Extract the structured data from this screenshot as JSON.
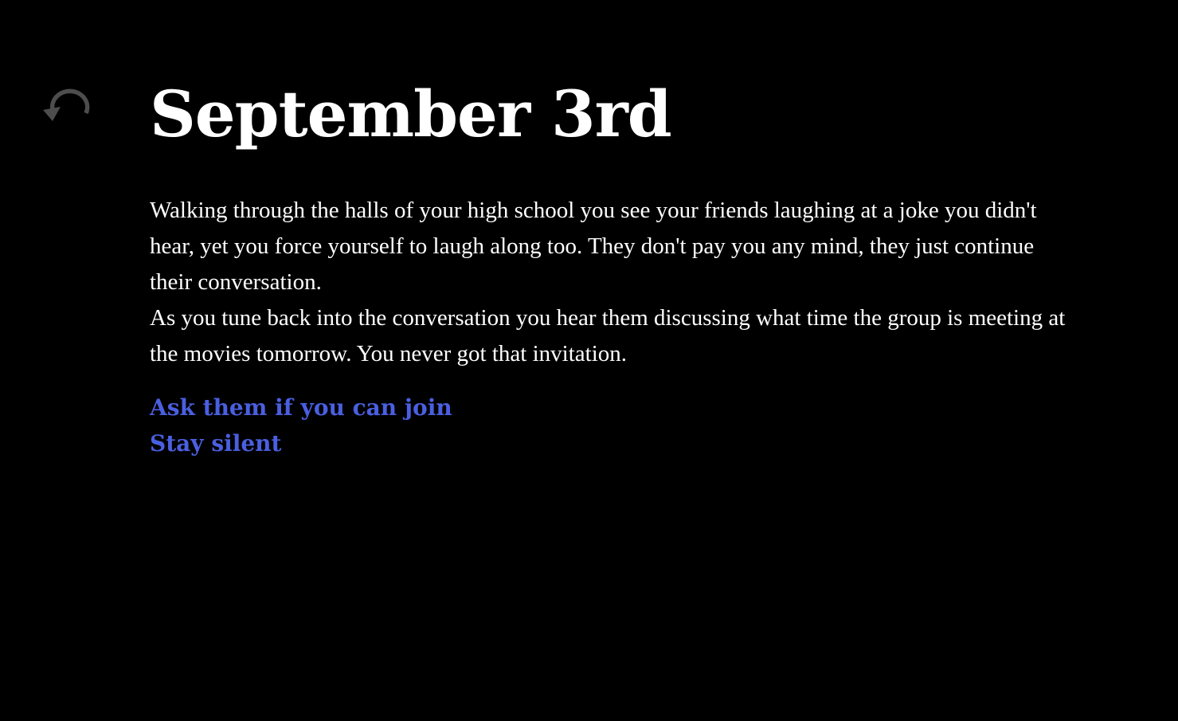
{
  "toolbar": {
    "undo_icon": "undo-arrow-icon",
    "undo_color": "#4d4d4d"
  },
  "passage": {
    "title": "September 3rd",
    "paragraphs": [
      "Walking through the halls of your high school you see your friends laughing at a joke you didn't hear, yet you force yourself to laugh along too. They don't pay you any mind, they just continue their conversation.",
      "As you tune back into the conversation you hear them discussing what time the group is meeting at the movies tomorrow. You never got that invitation."
    ],
    "choices": [
      "Ask them if you can join",
      "Stay silent"
    ]
  },
  "colors": {
    "background": "#000000",
    "text": "#ffffff",
    "link": "#4a5fe0"
  }
}
